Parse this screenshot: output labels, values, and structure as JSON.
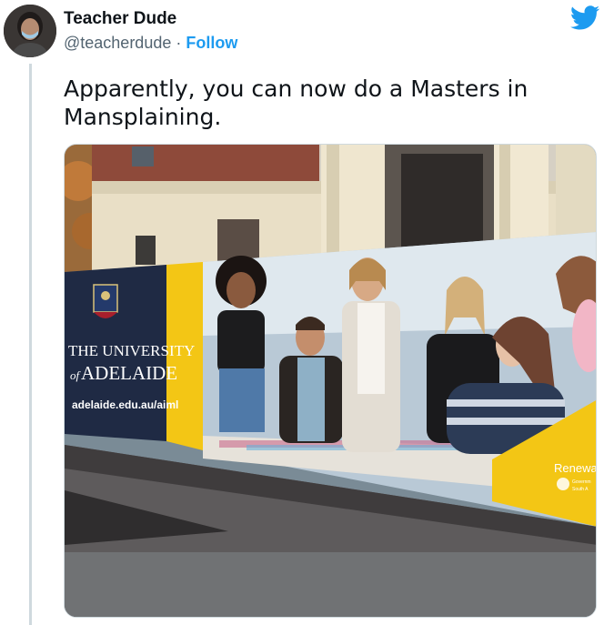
{
  "author": {
    "display_name": "Teacher Dude",
    "handle": "@teacherdude",
    "separator": "·",
    "follow_label": "Follow",
    "avatar_icon": "person-avatar-icon"
  },
  "brand_icon": "twitter-bird-icon",
  "tweet": {
    "text": "Apparently, you can now do a Masters in Mansplaining."
  },
  "photo": {
    "billboard_line1": "THE UNIVERSITY",
    "billboard_line2_prefix": "of",
    "billboard_line2": "ADELAIDE",
    "billboard_url": "adelaide.edu.au/aiml",
    "corner_text": "Renewa",
    "corner_small1": "Governm",
    "corner_small2": "South A"
  },
  "colors": {
    "link_blue": "#1d9bf0",
    "text_primary": "#0f1419",
    "text_secondary": "#536471",
    "billboard_navy": "#1f2a44",
    "billboard_yellow": "#f3c615"
  }
}
